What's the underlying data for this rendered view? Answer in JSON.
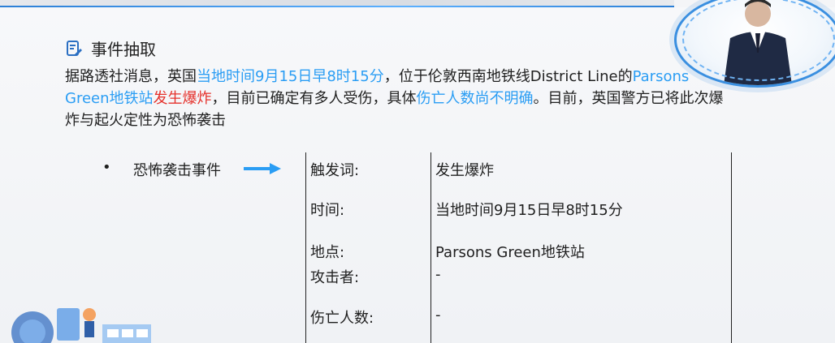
{
  "slide": {
    "heading": "事件抽取",
    "paragraph": [
      {
        "text": "据路透社消息，英国",
        "style": "normal"
      },
      {
        "text": "当地时间9月15日早8时15分",
        "style": "blue"
      },
      {
        "text": "，位于伦敦西南地铁线District Line的",
        "style": "normal"
      },
      {
        "text": "Parsons Green地铁站",
        "style": "blue"
      },
      {
        "text": "发生爆炸",
        "style": "red"
      },
      {
        "text": "，目前已确定有多人受伤，具体",
        "style": "normal"
      },
      {
        "text": "伤亡人数尚不明确",
        "style": "blue"
      },
      {
        "text": "。目前，英国警方已将此次爆炸与起火定性为恐怖袭击",
        "style": "normal"
      }
    ],
    "bullet_symbol": "•",
    "event_label": "恐怖袭击事件",
    "fields": [
      {
        "label": "触发词:",
        "value": "发生爆炸"
      },
      {
        "label": "时间:",
        "value": "当地时间9月15日早8时15分"
      },
      {
        "label": "地点:",
        "value": "Parsons Green地铁站"
      },
      {
        "label": "攻击者:",
        "value": "-"
      },
      {
        "label": "伤亡人数:",
        "value": "-"
      }
    ]
  },
  "colors": {
    "accent_blue": "#2a9df4",
    "highlight_red": "#e5312b",
    "arrow_blue": "#2a9df4"
  },
  "icons": {
    "heading_icon": "document-edit-icon",
    "arrow_icon": "right-arrow-icon"
  }
}
